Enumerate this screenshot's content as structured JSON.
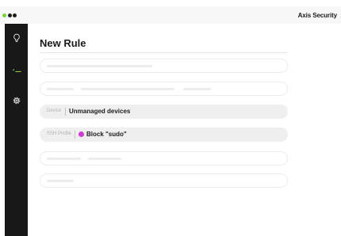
{
  "window": {
    "brand": "Axis Security"
  },
  "sidebar": {
    "items": [
      {
        "name": "lightbulb-icon"
      },
      {
        "name": "terminal-icon"
      },
      {
        "name": "gear-icon"
      }
    ],
    "accent_color": "#9ae04a"
  },
  "main": {
    "title": "New Rule",
    "fields": {
      "device": {
        "label": "Device",
        "value": "Unmanaged devices"
      },
      "ssh_profile": {
        "label": "SSH Profile",
        "value": "Block \"sudo\"",
        "tag_color": "#cc3fcf"
      }
    }
  },
  "colors": {
    "sidebar_bg": "#181818",
    "active_green": "#9ae04a",
    "window_dot_green": "#7bd63a"
  }
}
